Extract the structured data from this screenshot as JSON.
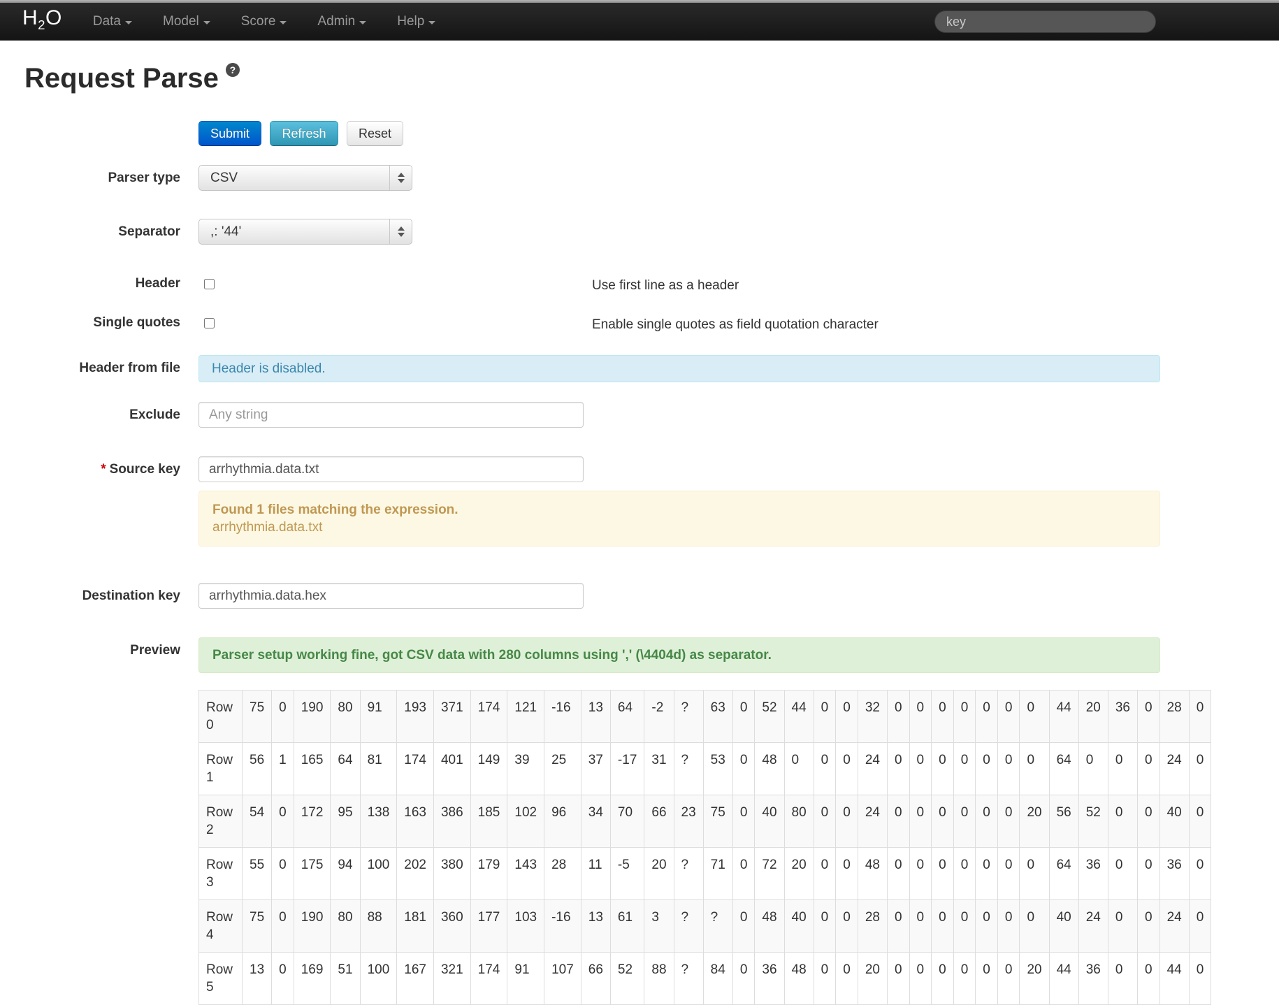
{
  "navbar": {
    "brand_main": "H",
    "brand_sub": "2",
    "brand_tail": "O",
    "menus": [
      {
        "label": "Data"
      },
      {
        "label": "Model"
      },
      {
        "label": "Score"
      },
      {
        "label": "Admin"
      },
      {
        "label": "Help"
      }
    ],
    "search_placeholder": "key"
  },
  "page": {
    "title": "Request Parse",
    "help_glyph": "?"
  },
  "toolbar": {
    "submit_label": "Submit",
    "refresh_label": "Refresh",
    "reset_label": "Reset"
  },
  "form": {
    "parser_type": {
      "label": "Parser type",
      "value": "CSV"
    },
    "separator": {
      "label": "Separator",
      "value": ",: '44'"
    },
    "header": {
      "label": "Header",
      "checked": false,
      "hint": "Use first line as a header"
    },
    "single_quotes": {
      "label": "Single quotes",
      "checked": false,
      "hint": "Enable single quotes as field quotation character"
    },
    "header_from_file": {
      "label": "Header from file",
      "message": "Header is disabled."
    },
    "exclude": {
      "label": "Exclude",
      "placeholder": "Any string",
      "value": ""
    },
    "source_key": {
      "required_marker": "*",
      "label": "Source key",
      "value": "arrhythmia.data.txt",
      "notice_title": "Found 1 files matching the expression.",
      "notice_file": "arrhythmia.data.txt"
    },
    "destination_key": {
      "label": "Destination key",
      "value": "arrhythmia.data.hex"
    },
    "preview": {
      "label": "Preview",
      "message": "Parser setup working fine, got CSV data with 280 columns using ',' (\\4404d) as separator."
    }
  },
  "preview_table": {
    "rows": [
      {
        "label": "Row 0",
        "values": [
          "75",
          "0",
          "190",
          "80",
          "91",
          "193",
          "371",
          "174",
          "121",
          "-16",
          "13",
          "64",
          "-2",
          "?",
          "63",
          "0",
          "52",
          "44",
          "0",
          "0",
          "32",
          "0",
          "0",
          "0",
          "0",
          "0",
          "0",
          "0",
          "44",
          "20",
          "36",
          "0",
          "28",
          "0"
        ]
      },
      {
        "label": "Row 1",
        "values": [
          "56",
          "1",
          "165",
          "64",
          "81",
          "174",
          "401",
          "149",
          "39",
          "25",
          "37",
          "-17",
          "31",
          "?",
          "53",
          "0",
          "48",
          "0",
          "0",
          "0",
          "24",
          "0",
          "0",
          "0",
          "0",
          "0",
          "0",
          "0",
          "64",
          "0",
          "0",
          "0",
          "24",
          "0"
        ]
      },
      {
        "label": "Row 2",
        "values": [
          "54",
          "0",
          "172",
          "95",
          "138",
          "163",
          "386",
          "185",
          "102",
          "96",
          "34",
          "70",
          "66",
          "23",
          "75",
          "0",
          "40",
          "80",
          "0",
          "0",
          "24",
          "0",
          "0",
          "0",
          "0",
          "0",
          "0",
          "20",
          "56",
          "52",
          "0",
          "0",
          "40",
          "0"
        ]
      },
      {
        "label": "Row 3",
        "values": [
          "55",
          "0",
          "175",
          "94",
          "100",
          "202",
          "380",
          "179",
          "143",
          "28",
          "11",
          "-5",
          "20",
          "?",
          "71",
          "0",
          "72",
          "20",
          "0",
          "0",
          "48",
          "0",
          "0",
          "0",
          "0",
          "0",
          "0",
          "0",
          "64",
          "36",
          "0",
          "0",
          "36",
          "0"
        ]
      },
      {
        "label": "Row 4",
        "values": [
          "75",
          "0",
          "190",
          "80",
          "88",
          "181",
          "360",
          "177",
          "103",
          "-16",
          "13",
          "61",
          "3",
          "?",
          "?",
          "0",
          "48",
          "40",
          "0",
          "0",
          "28",
          "0",
          "0",
          "0",
          "0",
          "0",
          "0",
          "0",
          "40",
          "24",
          "0",
          "0",
          "24",
          "0"
        ]
      },
      {
        "label": "Row 5",
        "values": [
          "13",
          "0",
          "169",
          "51",
          "100",
          "167",
          "321",
          "174",
          "91",
          "107",
          "66",
          "52",
          "88",
          "?",
          "84",
          "0",
          "36",
          "48",
          "0",
          "0",
          "20",
          "0",
          "0",
          "0",
          "0",
          "0",
          "0",
          "20",
          "44",
          "36",
          "0",
          "0",
          "44",
          "0"
        ]
      }
    ]
  },
  "colors": {
    "navbar_bg": "#1b1b1b",
    "submit_blue": "#006dcc",
    "refresh_teal": "#49afcd",
    "info_bg": "#d9edf7",
    "info_text": "#3a87ad",
    "warning_bg": "#fcf8e3",
    "warning_text": "#c09853",
    "success_bg": "#dff0d8",
    "success_text": "#468847",
    "required_red": "#cc0000",
    "table_stripe": "#f9f9f9"
  }
}
